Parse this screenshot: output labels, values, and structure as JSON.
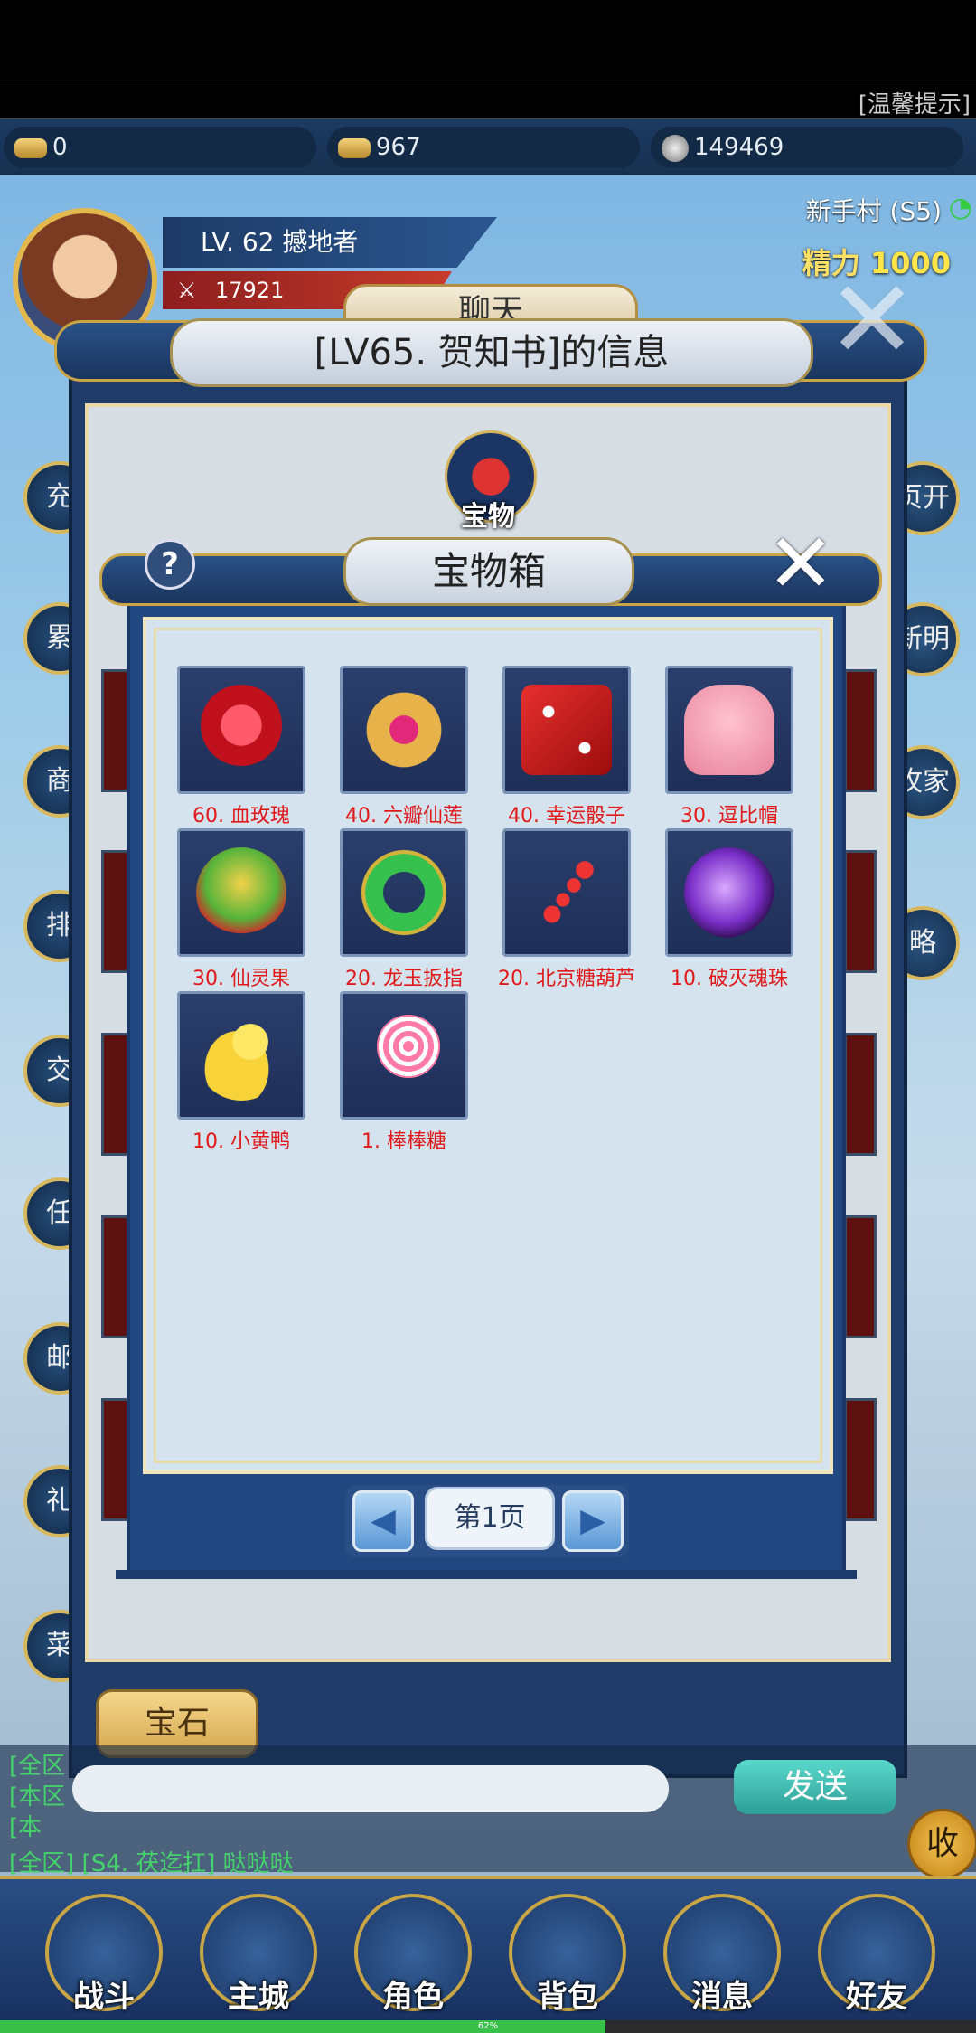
{
  "top_tip": "[温馨提示]",
  "currency": {
    "gold_ingot": "0",
    "bound_ingot": "967",
    "silver": "149469"
  },
  "player": {
    "level_title": "LV. 62 撼地者",
    "power": "17921"
  },
  "server": "新手村 (S5)",
  "energy": {
    "label": "精力",
    "value": "1000"
  },
  "chat_tab": "聊天",
  "info_dialog": {
    "title": "[LV65. 贺知书]的信息"
  },
  "left_side_labels": [
    "充",
    "累",
    "商",
    "排",
    "交",
    "任",
    "邮",
    "礼",
    "菜"
  ],
  "right_side_labels": [
    "页开",
    "新明",
    "攻家",
    "略"
  ],
  "treasure_badge": "宝物",
  "treasure_box": {
    "title": "宝物箱",
    "help": "?",
    "items": [
      {
        "label": "60. 血玫瑰",
        "icon": "rose-icon",
        "color": "#d81c28"
      },
      {
        "label": "40. 六瓣仙莲",
        "icon": "lotus-icon",
        "color": "#d9a04a"
      },
      {
        "label": "40. 幸运骰子",
        "icon": "dice-icon",
        "color": "#c81414"
      },
      {
        "label": "30. 逗比帽",
        "icon": "cat-hat-icon",
        "color": "#f29bb0"
      },
      {
        "label": "30. 仙灵果",
        "icon": "fruit-icon",
        "color": "#69b832"
      },
      {
        "label": "20. 龙玉扳指",
        "icon": "jade-ring-icon",
        "color": "#2ea84a"
      },
      {
        "label": "20. 北京糖葫芦",
        "icon": "candied-haws-icon",
        "color": "#c23a2a"
      },
      {
        "label": "10. 破灭魂珠",
        "icon": "soul-orb-icon",
        "color": "#8a3fd6"
      },
      {
        "label": "10. 小黄鸭",
        "icon": "duck-icon",
        "color": "#f2cf2b"
      },
      {
        "label": "1. 棒棒糖",
        "icon": "lollipop-icon",
        "color": "#f07aa0"
      }
    ],
    "page": "第1页"
  },
  "gem_button": "宝石",
  "chat_lines": [
    "[全区",
    "[本区",
    "[本",
    "[全区] [S4. 茯迄扛] 哒哒哒"
  ],
  "send_button": "发送",
  "collapse_button": "收",
  "nav": [
    "战斗",
    "主城",
    "角色",
    "背包",
    "消息",
    "好友"
  ],
  "progress": {
    "fraction": 0.62,
    "label": "62%"
  }
}
